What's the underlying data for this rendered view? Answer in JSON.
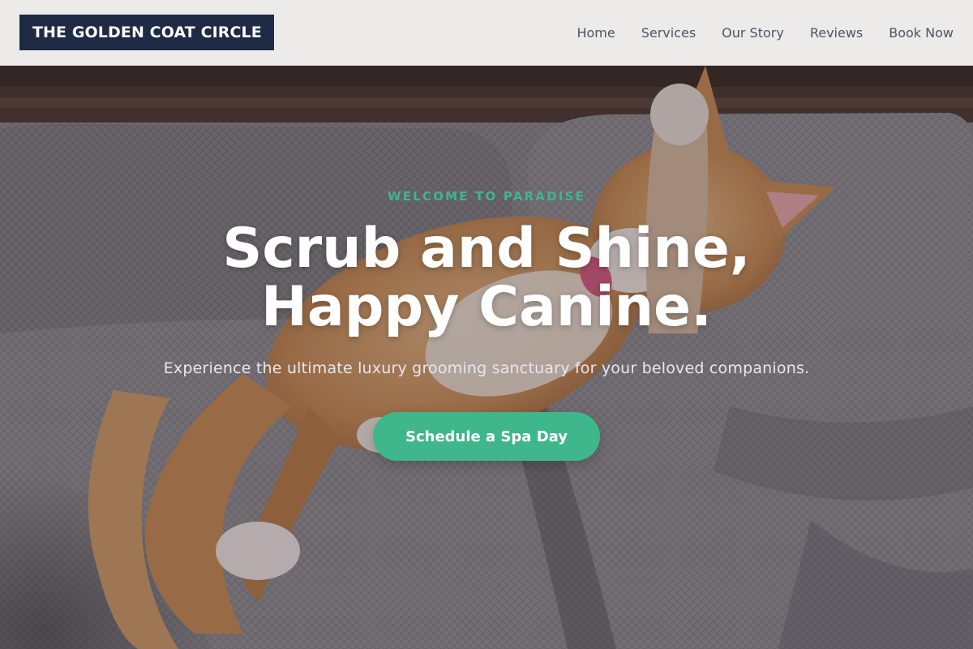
{
  "header": {
    "logo_text": "THE GOLDEN COAT CIRCLE",
    "nav": [
      {
        "label": "Home"
      },
      {
        "label": "Services"
      },
      {
        "label": "Our Story"
      },
      {
        "label": "Reviews"
      },
      {
        "label": "Book Now"
      }
    ]
  },
  "hero": {
    "eyebrow": "WELCOME TO PARADISE",
    "headline_line1": "Scrub and Shine,",
    "headline_line2": "Happy Canine.",
    "subtext": "Experience the ultimate luxury grooming sanctuary for your beloved companions.",
    "cta_label": "Schedule a Spa Day",
    "background_image": "orange-cat-lounging-on-gray-sofa"
  },
  "colors": {
    "brand_navy": "#1f2a44",
    "accent_green": "#3fb68b",
    "header_bg": "#ecebea",
    "nav_text": "#4b5563"
  }
}
